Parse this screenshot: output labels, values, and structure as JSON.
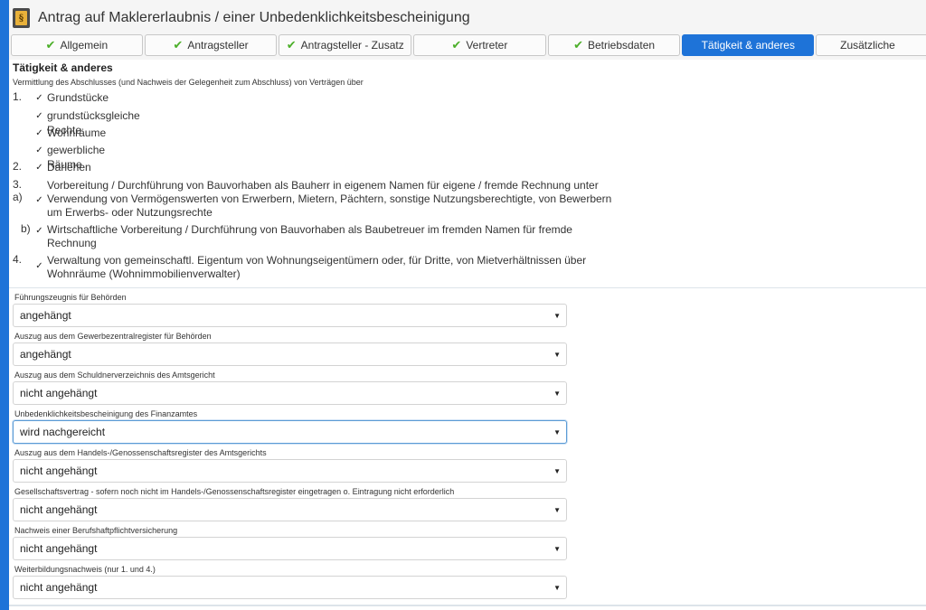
{
  "window": {
    "title": "Antrag auf Maklererlaubnis / einer Unbedenklichkeitsbescheinigung",
    "icon_glyph": "§"
  },
  "tabs": [
    {
      "label": "Allgemein",
      "done": true
    },
    {
      "label": "Antragsteller",
      "done": true
    },
    {
      "label": "Antragsteller - Zusatz",
      "done": true
    },
    {
      "label": "Vertreter",
      "done": true
    },
    {
      "label": "Betriebsdaten",
      "done": true
    },
    {
      "label": "Tätigkeit & anderes",
      "done": false,
      "active": true
    },
    {
      "label": "Zusätzliche",
      "done": false
    }
  ],
  "section": {
    "title": "Tätigkeit & anderes",
    "intro": "Vermittlung des Abschlusses (und Nachweis der Gelegenheit zum Abschluss) von Verträgen über",
    "items": {
      "n1": "1.",
      "grundstuecke": "Grundstücke",
      "grundstuecksgleiche": "grundstücksgleiche Rechte",
      "wohnraeume": "Wohnräume",
      "gewerbliche": "gewerbliche Räume",
      "n2": "2.",
      "darlehen": "Darlehen",
      "n3a": "3. a)",
      "bauherr_line1": "Vorbereitung / Durchführung von Bauvorhaben als Bauherr in eigenem Namen für eigene / fremde Rechnung unter",
      "bauherr_line2": "Verwendung von Vermögenswerten von Erwerbern, Mietern, Pächtern, sonstige Nutzungsberechtigte, von Bewerbern",
      "bauherr_line3": "um Erwerbs- oder Nutzungsrechte",
      "n3b": "b)",
      "baubetreuer_line1": "Wirtschaftliche Vorbereitung / Durchführung von Bauvorhaben als Baubetreuer im fremden Namen für fremde",
      "baubetreuer_line2": "Rechnung",
      "n4": "4.",
      "verwaltung_line1": "Verwaltung von gemeinschaftl. Eigentum von Wohnungseigentümern oder, für Dritte, von Mietverhältnissen über",
      "verwaltung_line2": "Wohnräume (Wohnimmobilienverwalter)"
    },
    "checked": "✓"
  },
  "fields": [
    {
      "label": "Führungszeugnis für Behörden",
      "value": "angehängt"
    },
    {
      "label": "Auszug aus dem Gewerbezentralregister für Behörden",
      "value": "angehängt"
    },
    {
      "label": "Auszug aus dem Schuldnerverzeichnis des Amtsgericht",
      "value": "nicht angehängt"
    },
    {
      "label": "Unbedenklichkeitsbescheinigung des Finanzamtes",
      "value": "wird nachgereicht"
    },
    {
      "label": "Auszug aus dem Handels-/Genossenschaftsregister des Amtsgerichts",
      "value": "nicht angehängt"
    },
    {
      "label": "Gesellschaftsvertrag - sofern noch nicht im Handels-/Genossenschaftsregister eingetragen o. Eintragung nicht erforderlich",
      "value": "nicht angehängt"
    },
    {
      "label": "Nachweis einer Berufshaftpflichtversicherung",
      "value": "nicht angehängt"
    },
    {
      "label": "Weiterbildungsnachweis (nur 1. und 4.)",
      "value": "nicht angehängt"
    }
  ],
  "colors": {
    "accent": "#1e73d8",
    "check_green": "#4caf2a"
  }
}
